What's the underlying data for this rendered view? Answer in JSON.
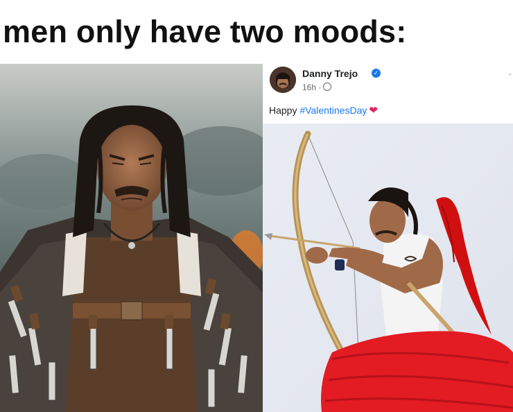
{
  "meme": {
    "title": "men only have two moods:"
  },
  "post": {
    "author": "Danny Trejo",
    "time": "16h ·",
    "text_prefix": "Happy ",
    "hashtag": "#ValentinesDay",
    "heart": "❤",
    "more": "·"
  },
  "colors": {
    "link": "#1877f2",
    "heart": "#e0245e",
    "tutu": "#e31b23",
    "wing": "#d01010"
  },
  "icons": {
    "verified": "verified-badge-icon",
    "globe": "globe-icon"
  }
}
